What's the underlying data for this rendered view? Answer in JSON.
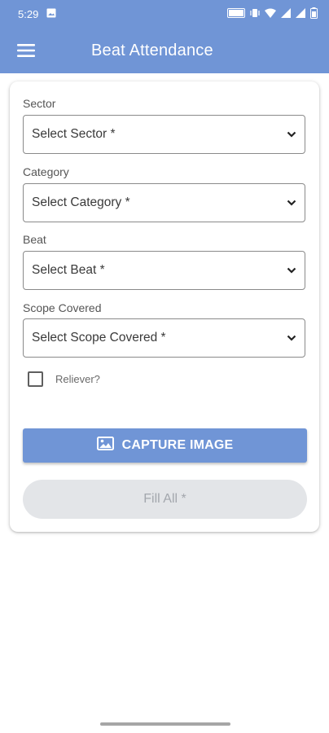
{
  "status_bar": {
    "time": "5:29",
    "icons": [
      "image-icon",
      "volte-icon",
      "vibrate-icon",
      "wifi-icon",
      "signal-icon",
      "signal-icon",
      "battery-icon"
    ]
  },
  "app_bar": {
    "title": "Beat Attendance",
    "menu_icon": "hamburger-menu-icon"
  },
  "form": {
    "fields": [
      {
        "label": "Sector",
        "placeholder": "Select Sector *"
      },
      {
        "label": "Category",
        "placeholder": "Select Category *"
      },
      {
        "label": "Beat",
        "placeholder": "Select Beat *"
      },
      {
        "label": "Scope Covered",
        "placeholder": "Select Scope Covered *"
      }
    ],
    "reliever": {
      "label": "Reliever?",
      "checked": false
    },
    "capture_button": {
      "label": "CAPTURE IMAGE",
      "icon": "image-icon"
    },
    "submit_button": {
      "label": "Fill All *"
    }
  },
  "colors": {
    "primary": "#7095d6",
    "disabled_bg": "#e3e5e8",
    "disabled_text": "#a3a7ad"
  }
}
